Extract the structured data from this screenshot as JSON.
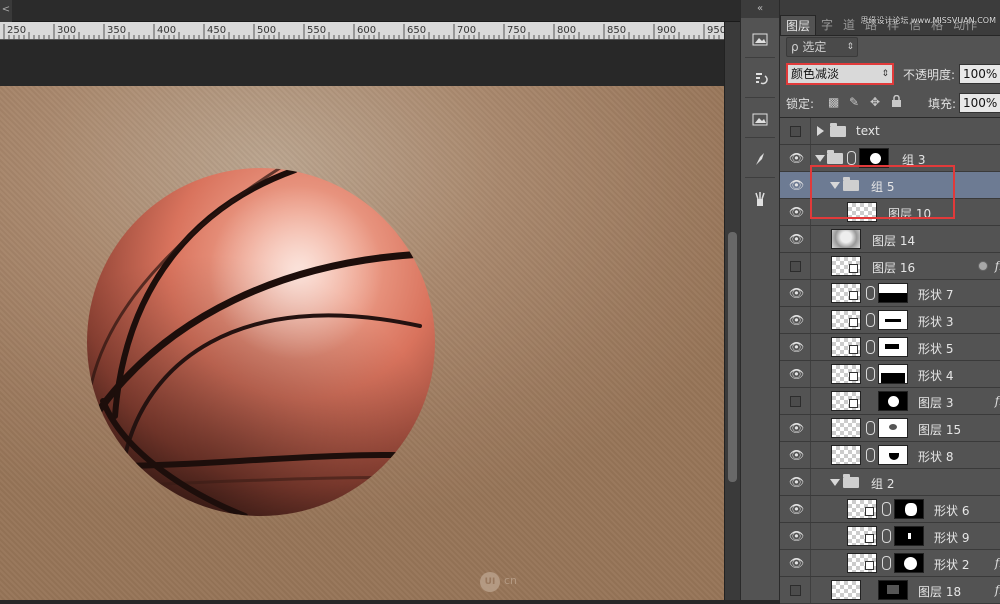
{
  "ruler": {
    "ticks": [
      "250",
      "300",
      "350",
      "400",
      "450",
      "500",
      "550",
      "600",
      "650",
      "700",
      "750",
      "800",
      "850",
      "900",
      "950"
    ]
  },
  "ruler_corner_glyph": "<",
  "toolstrip": {
    "collapse_glyph": "«"
  },
  "panel": {
    "tabs": [
      "图层",
      "字",
      "道",
      "路",
      "样",
      "信",
      "格",
      "动作"
    ],
    "active_tab": "图层",
    "tab_watermark": "思缘设计论坛 www.MISSVUAN.COM",
    "filter_label": "ρ 选定",
    "blend_mode": "颜色减淡",
    "opacity_label": "不透明度:",
    "opacity_value": "100%",
    "lock_label": "锁定:",
    "fill_label": "填充:",
    "fill_value": "100%"
  },
  "layers": [
    {
      "name": "text"
    },
    {
      "name": "组 3"
    },
    {
      "name": "组 5"
    },
    {
      "name": "图层 10"
    },
    {
      "name": "图层 14"
    },
    {
      "name": "图层 16",
      "fx": "fx"
    },
    {
      "name": "形状 7"
    },
    {
      "name": "形状 3"
    },
    {
      "name": "形状 5"
    },
    {
      "name": "形状 4"
    },
    {
      "name": "图层 3",
      "fx": "fx"
    },
    {
      "name": "图层 15"
    },
    {
      "name": "形状 8"
    },
    {
      "name": "组 2"
    },
    {
      "name": "形状 6"
    },
    {
      "name": "形状 9"
    },
    {
      "name": "形状 2",
      "fx": "fx"
    },
    {
      "name": "图层 18",
      "fx": "fx"
    }
  ],
  "canvas": {
    "watermark": "cn",
    "watermark_logo": "UI"
  },
  "colors": {
    "accent_highlight": "#e13a3a",
    "selected_row": "#6d7b93",
    "panel_bg": "#535353"
  }
}
